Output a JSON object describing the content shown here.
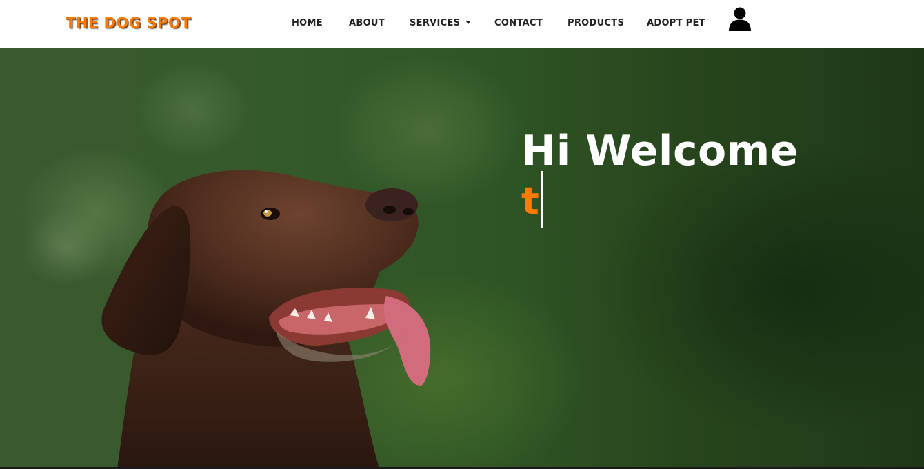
{
  "brand": {
    "logo_text": "THE DOG SPOT",
    "accent_color": "#ff7a00"
  },
  "nav": {
    "home": "HOME",
    "about": "ABOUT",
    "services": "SERVICES",
    "contact": "CONTACT",
    "products": "PRODUCTS",
    "adopt": "ADOPT PET",
    "user_icon": "user-icon"
  },
  "hero": {
    "title": "Hi Welcome",
    "typed_text": "t",
    "image": "chocolate-labrador-photo"
  }
}
